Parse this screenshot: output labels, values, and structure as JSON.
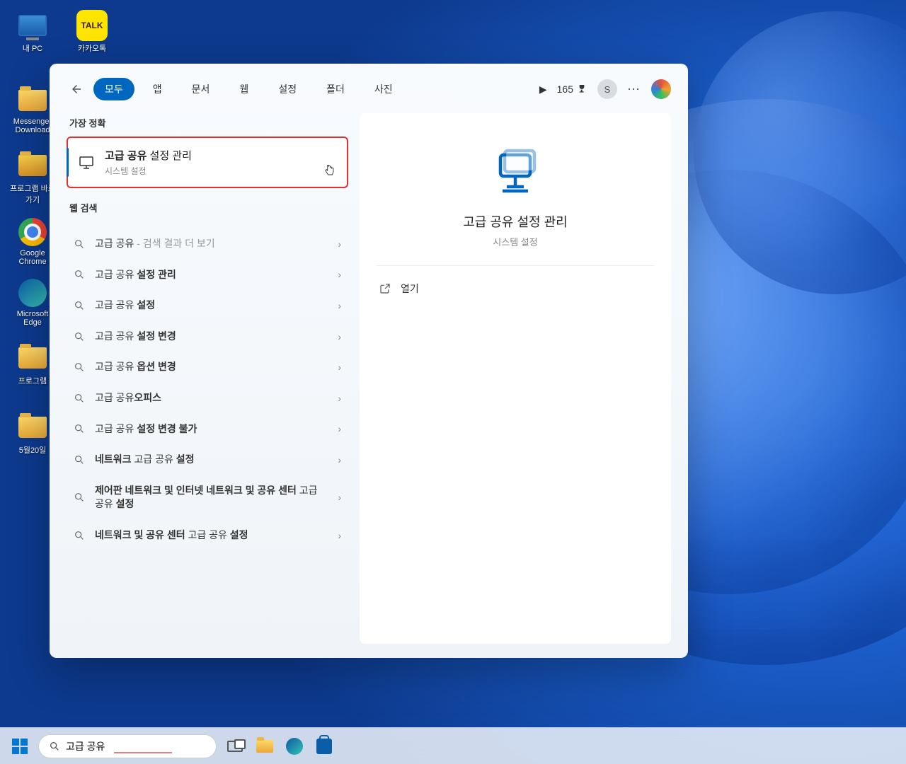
{
  "desktop": {
    "icons": [
      {
        "name": "내 PC"
      },
      {
        "name": "카카오톡"
      },
      {
        "name": "Messenger Download"
      },
      {
        "name": "프로그램 바로 가기"
      },
      {
        "name": "Google Chrome"
      },
      {
        "name": "Microsoft Edge"
      },
      {
        "name": "프로그램"
      },
      {
        "name": "5월20일"
      }
    ]
  },
  "search": {
    "tabs": [
      "모두",
      "앱",
      "문서",
      "웹",
      "설정",
      "폴더",
      "사진"
    ],
    "active_tab": "모두",
    "points": "165",
    "avatar_letter": "S",
    "section_best": "가장 정확",
    "best_match": {
      "title_bold": "고급 공유",
      "title_rest": " 설정 관리",
      "subtitle": "시스템 설정"
    },
    "section_web": "웹 검색",
    "web_results": [
      {
        "pre": "고급 공유",
        "bold": "",
        "post": " - 검색 결과 더 보기",
        "light": true
      },
      {
        "pre": "고급 공유 ",
        "bold": "설정 관리",
        "post": ""
      },
      {
        "pre": "고급 공유 ",
        "bold": "설정",
        "post": ""
      },
      {
        "pre": "고급 공유 ",
        "bold": "설정 변경",
        "post": ""
      },
      {
        "pre": "고급 공유 ",
        "bold": "옵션 변경",
        "post": ""
      },
      {
        "pre": "고급 공유",
        "bold": "오피스",
        "post": ""
      },
      {
        "pre": "고급 공유 ",
        "bold": "설정 변경 불가",
        "post": ""
      },
      {
        "pre": "",
        "bold": "네트워크",
        "post": " 고급 공유 ",
        "bold2": "설정"
      },
      {
        "pre": "",
        "bold": "제어판 네트워크 및 인터넷 네트워크 및 공유 센터",
        "post": " 고급 공유 ",
        "bold2": "설정"
      },
      {
        "pre": "",
        "bold": "네트워크 및 공유 센터",
        "post": " 고급 공유 ",
        "bold2": "설정"
      }
    ],
    "detail": {
      "title": "고급 공유 설정 관리",
      "subtitle": "시스템 설정",
      "open_label": "열기"
    }
  },
  "taskbar": {
    "search_value": "고급 공유"
  }
}
